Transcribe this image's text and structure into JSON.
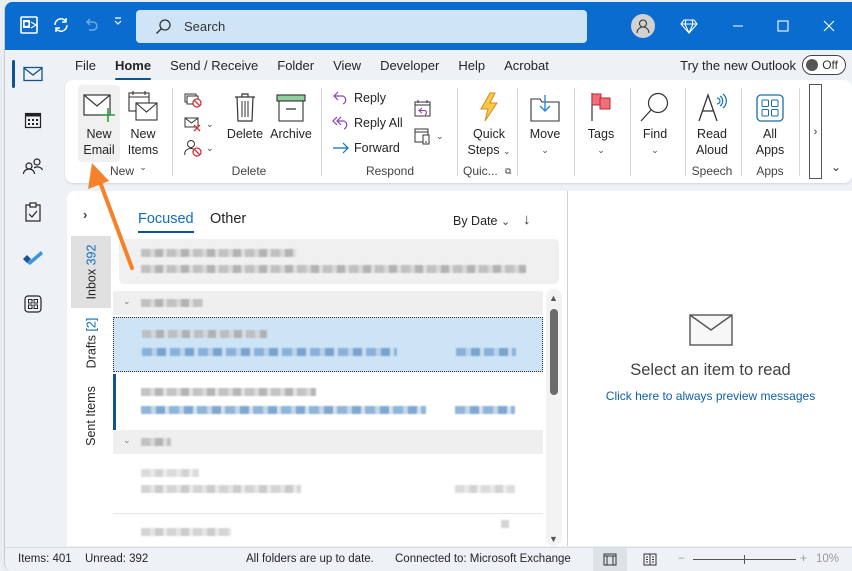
{
  "titlebar": {
    "search_placeholder": "Search"
  },
  "menu": {
    "tabs": [
      "File",
      "Home",
      "Send / Receive",
      "Folder",
      "View",
      "Developer",
      "Help",
      "Acrobat"
    ],
    "active_tab": "Home",
    "try_new_outlook": "Try the new Outlook",
    "toggle_state": "Off"
  },
  "ribbon": {
    "new_email": [
      "New",
      "Email"
    ],
    "new_items": [
      "New",
      "Items"
    ],
    "delete": "Delete",
    "archive": "Archive",
    "reply": "Reply",
    "reply_all": "Reply All",
    "forward": "Forward",
    "quick_steps": [
      "Quick",
      "Steps"
    ],
    "move": "Move",
    "tags": "Tags",
    "find": "Find",
    "read_aloud": [
      "Read",
      "Aloud"
    ],
    "all_apps": [
      "All",
      "Apps"
    ],
    "groups": {
      "new": "New",
      "delete": "Delete",
      "respond": "Respond",
      "quick": "Quic...",
      "speech": "Speech",
      "apps": "Apps"
    }
  },
  "folders": {
    "inbox": {
      "label": "Inbox",
      "count": "392"
    },
    "drafts": {
      "label": "Drafts",
      "count": "[2]"
    },
    "sent": {
      "label": "Sent Items"
    }
  },
  "message_list": {
    "tabs": [
      "Focused",
      "Other"
    ],
    "active_tab": "Focused",
    "sort_by": "By Date",
    "content_obscured": true
  },
  "reading_pane": {
    "title": "Select an item to read",
    "link": "Click here to always preview messages"
  },
  "status": {
    "items": "Items: 401",
    "unread": "Unread: 392",
    "sync": "All folders are up to date.",
    "connection": "Connected to: Microsoft Exchange",
    "zoom": "10%"
  },
  "colors": {
    "titlebar": "#0a6cce",
    "accent": "#0f548c",
    "link": "#0f5fa8",
    "annotation_arrow": "#f5822a"
  }
}
